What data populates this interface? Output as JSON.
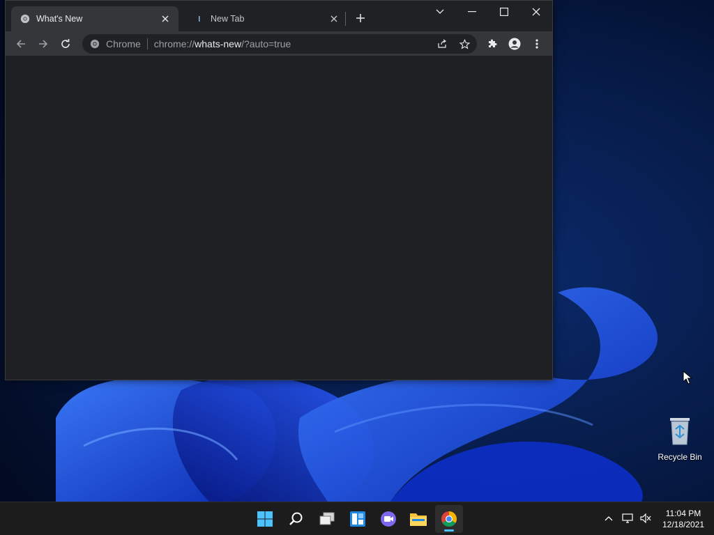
{
  "browser": {
    "tabs": [
      {
        "title": "What's New",
        "active": true
      },
      {
        "title": "New Tab",
        "active": false
      }
    ],
    "omnibox": {
      "chip": "Chrome",
      "url_scheme": "chrome://",
      "url_host": "whats-new",
      "url_rest": "/?auto=true"
    }
  },
  "desktop": {
    "icons": [
      {
        "label": "Recycle Bin"
      }
    ]
  },
  "taskbar": {
    "clock_time": "11:04 PM",
    "clock_date": "12/18/2021"
  },
  "colors": {
    "window_bg": "#202124",
    "toolbar_bg": "#35363a",
    "content_bg": "#1f2023",
    "taskbar_bg": "#1c1c1c",
    "accent": "#4cc2ff",
    "wallpaper_blue": "#1f4fe6"
  }
}
